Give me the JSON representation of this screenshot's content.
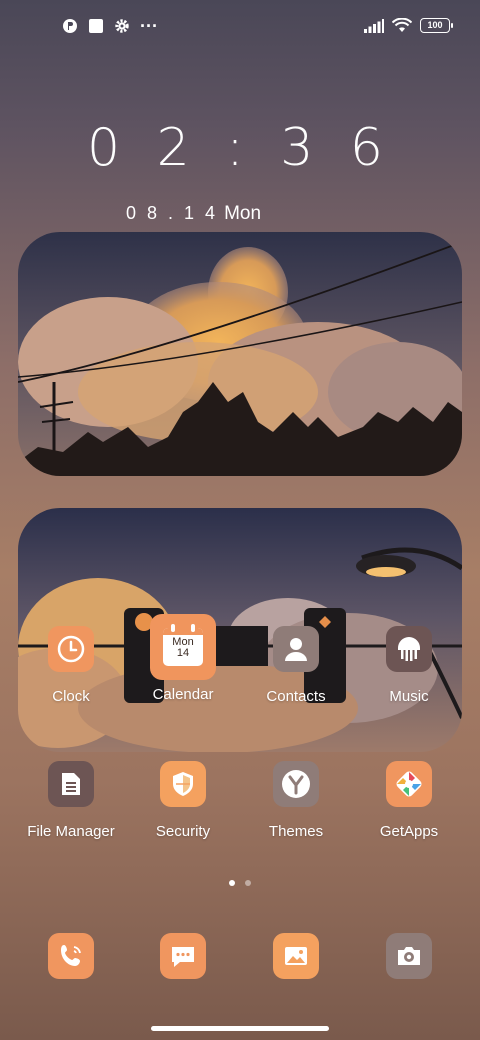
{
  "status_bar": {
    "left_icons": [
      "app-notification-icon",
      "square-notification-icon",
      "settings-notification-icon",
      "more-dots-icon"
    ],
    "more_dots": "···",
    "battery": "100",
    "right_icons": [
      "signal-icon",
      "wifi-icon",
      "battery-icon"
    ]
  },
  "clock": {
    "time": "02:36",
    "date": "08.14",
    "day": "Mon"
  },
  "widgets": [
    "sunset-photo-widget",
    "street-photo-widget"
  ],
  "apps": [
    {
      "label": "Clock",
      "icon": "clock-icon",
      "color": "#f0965f"
    },
    {
      "label": "Calendar",
      "icon": "calendar-icon",
      "color": "#f0955d",
      "icon_text_top": "Mon",
      "icon_text_bottom": "14"
    },
    {
      "label": "Contacts",
      "icon": "contacts-icon",
      "color": "#8f7c78"
    },
    {
      "label": "Music",
      "icon": "music-icon",
      "color": "#6d5554"
    },
    {
      "label": "File Manager",
      "icon": "file-manager-icon",
      "color": "#6d5554"
    },
    {
      "label": "Security",
      "icon": "security-icon",
      "color": "#f4a15f"
    },
    {
      "label": "Themes",
      "icon": "themes-icon",
      "color": "#8f7c78"
    },
    {
      "label": "GetApps",
      "icon": "getapps-icon",
      "color": "#f0965f"
    }
  ],
  "page_indicator": {
    "pages": 2,
    "current": 1
  },
  "dock": [
    {
      "icon": "phone-icon",
      "color": "#f0965f"
    },
    {
      "icon": "messages-icon",
      "color": "#f0965f"
    },
    {
      "icon": "gallery-icon",
      "color": "#f4a15f"
    },
    {
      "icon": "camera-icon",
      "color": "#8f7c78"
    }
  ]
}
